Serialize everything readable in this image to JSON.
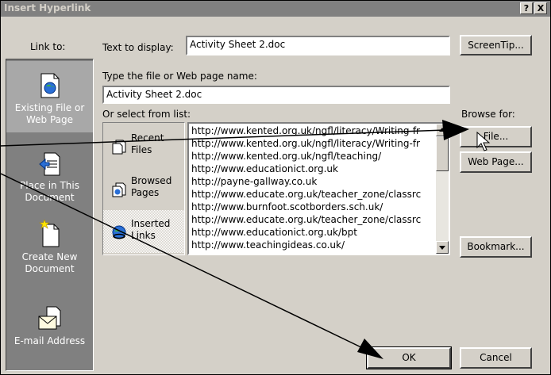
{
  "window": {
    "title": "Insert Hyperlink",
    "help_label": "?",
    "close_label": "X"
  },
  "sidebar": {
    "heading": "Link to:",
    "items": [
      {
        "line1": "Existing File or",
        "line2": "Web Page",
        "selected": true,
        "icon": "existing-file-icon"
      },
      {
        "line1": "Place in This",
        "line2": "Document",
        "selected": false,
        "icon": "place-in-document-icon"
      },
      {
        "line1": "Create New",
        "line2": "Document",
        "selected": false,
        "icon": "create-new-document-icon"
      },
      {
        "line1": "E-mail Address",
        "line2": "",
        "selected": false,
        "icon": "email-icon"
      }
    ]
  },
  "text_to_display": {
    "label": "Text to display:",
    "value": "Activity Sheet 2.doc"
  },
  "screentip_button": "ScreenTip...",
  "file_name": {
    "label": "Type the file or Web page name:",
    "value": "Activity Sheet 2.doc"
  },
  "select_from_list": {
    "label": "Or select from list:",
    "categories": [
      {
        "line1": "Recent",
        "line2": "Files",
        "icon": "recent-files-icon",
        "selected": false
      },
      {
        "line1": "Browsed",
        "line2": "Pages",
        "icon": "browsed-pages-icon",
        "selected": false
      },
      {
        "line1": "Inserted",
        "line2": "Links",
        "icon": "inserted-links-icon",
        "selected": true
      }
    ],
    "urls": [
      "http://www.kented.org.uk/ngfl/literacy/Writing-fr",
      "http://www.kented.org.uk/ngfl/literacy/Writing-fr",
      "http://www.kented.org.uk/ngfl/teaching/",
      "http://www.educationict.org.uk",
      "http://payne-gallway.co.uk",
      "http://www.educate.org.uk/teacher_zone/classrc",
      "http://www.burnfoot.scotborders.sch.uk/",
      "http://www.educate.org.uk/teacher_zone/classrc",
      "http://www.educationict.org.uk/bpt",
      "http://www.teachingideas.co.uk/"
    ]
  },
  "browse_for": {
    "label": "Browse for:",
    "file_button": "File...",
    "web_page_button": "Web Page..."
  },
  "bookmark_button": "Bookmark...",
  "ok_button": "OK",
  "cancel_button": "Cancel"
}
